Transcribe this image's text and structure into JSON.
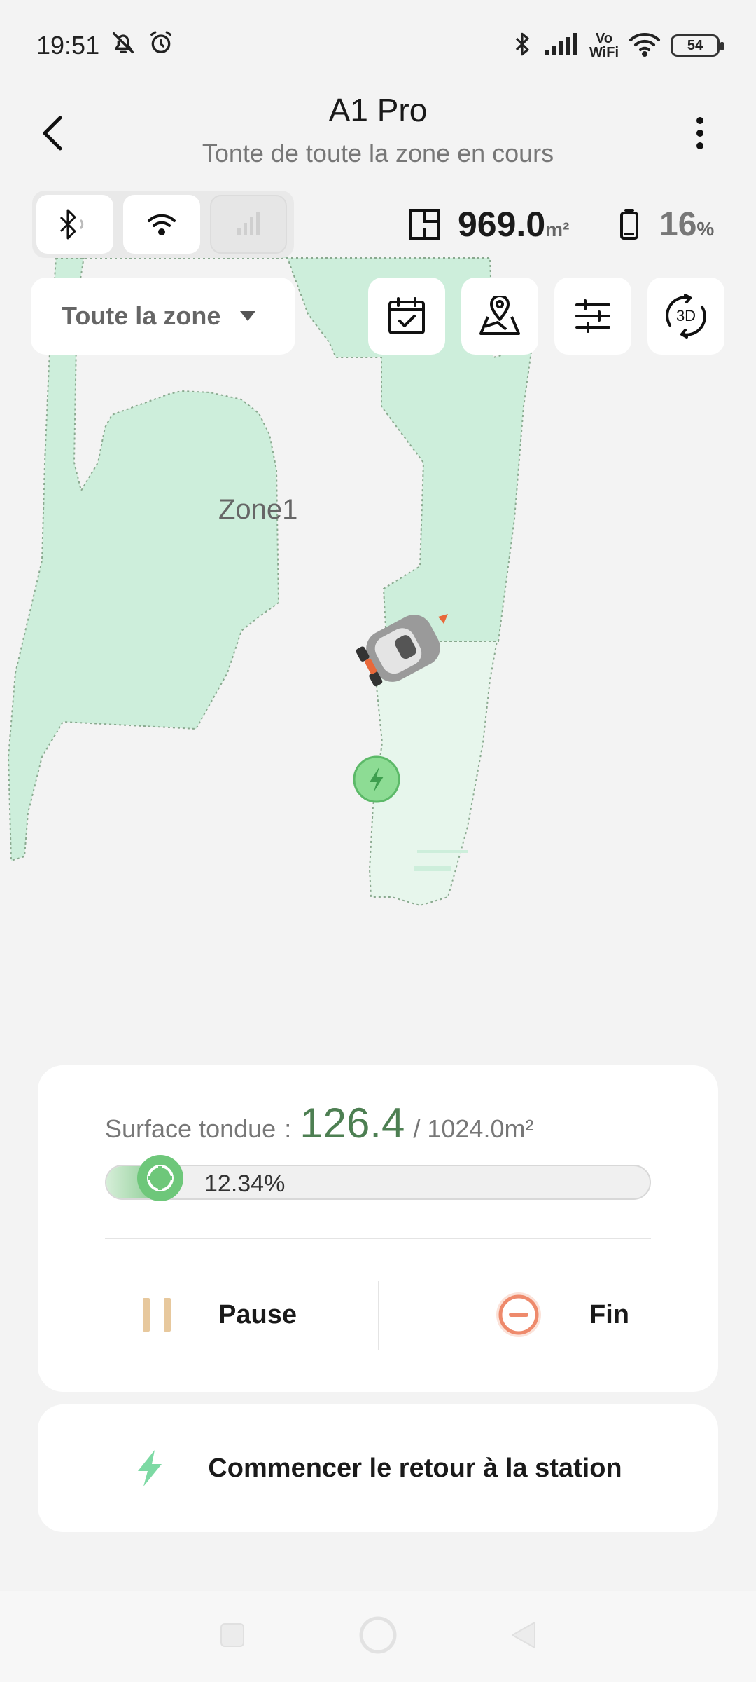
{
  "status_bar": {
    "time": "19:51",
    "vowifi_top": "Vo",
    "vowifi_bottom": "WiFi",
    "battery": "54",
    "icons": [
      "bell-off-icon",
      "alarm-icon",
      "bluetooth-icon",
      "signal-icon",
      "wifi-icon",
      "battery-icon"
    ]
  },
  "header": {
    "title": "A1 Pro",
    "subtitle": "Tonte de toute la zone en cours"
  },
  "connectivity": {
    "bluetooth": "connected",
    "wifi": "connected",
    "cellular": "disconnected"
  },
  "stats": {
    "area_value": "969.0",
    "area_unit": "m²",
    "battery_value": "16",
    "battery_unit": "%"
  },
  "map": {
    "zone_name": "Zone1",
    "zone_select_label": "Toute la zone",
    "tools": [
      "schedule-calendar",
      "map-edit",
      "settings-sliders",
      "3d-view"
    ],
    "tool_3d_label": "3D"
  },
  "progress": {
    "label": "Surface tondue",
    "separator": ":",
    "mowed": "126.4",
    "total": "/ 1024.0m²",
    "percent_text": "12.34%",
    "percent_value": 0.1234
  },
  "actions": {
    "pause_label": "Pause",
    "fin_label": "Fin",
    "return_label": "Commencer le retour à la station"
  },
  "colors": {
    "zone_fill": "#cdeedb",
    "zone_fill_light": "#e7f6ec",
    "mowed_green": "#4d7f52",
    "progress_green": "#6ec77a",
    "pause_color": "#e7c89d",
    "fin_color": "#ee8a6c",
    "bolt_color": "#7cd9a3"
  }
}
